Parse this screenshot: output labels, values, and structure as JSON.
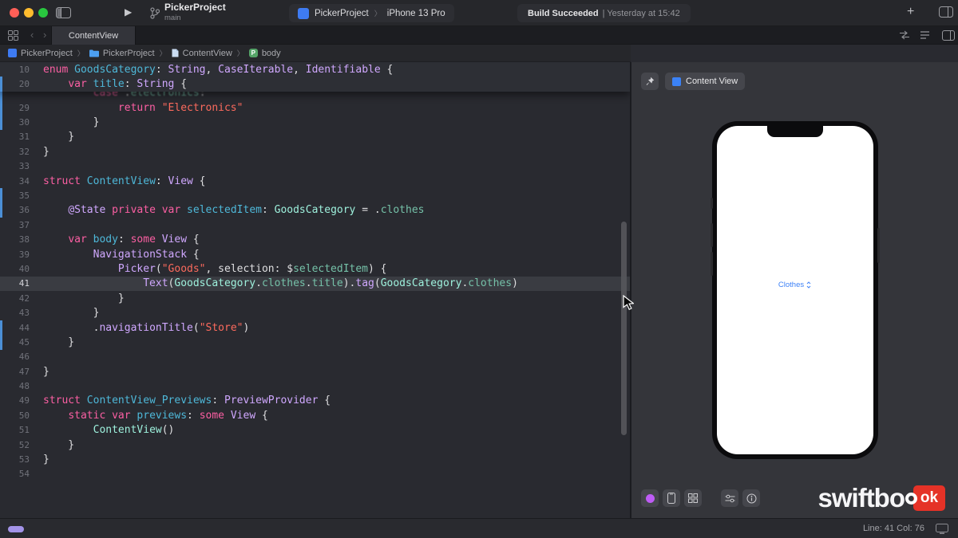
{
  "icons": {
    "chevron": "〉",
    "back": "‹",
    "forward": "›",
    "plus": "+",
    "play": "▶",
    "body_badge": "P"
  },
  "toolbar": {
    "project_name": "PickerProject",
    "branch_name": "main",
    "scheme_name": "PickerProject",
    "run_destination": "iPhone 13 Pro",
    "build_status": "Build Succeeded",
    "build_time": "| Yesterday at 15:42"
  },
  "tabbar": {
    "active_tab": "ContentView"
  },
  "jumpbar": {
    "items": [
      {
        "label": "PickerProject"
      },
      {
        "label": "PickerProject"
      },
      {
        "label": "ContentView"
      },
      {
        "label": "body"
      }
    ]
  },
  "syntax": {
    "k": "#FC5FA3",
    "s": "#FC6A5D",
    "d": "#4EB8D9",
    "v": "#D0A8FF",
    "m": "#9EF1DD",
    "g": "#75C1A8",
    "a": "#D0A8FF",
    "p": "#DFDFE1"
  },
  "code": {
    "current": "41",
    "sticky": [
      {
        "n": "10",
        "chg": false,
        "toks": [
          [
            "k",
            "enum"
          ],
          [
            "p",
            " "
          ],
          [
            "d",
            "GoodsCategory"
          ],
          [
            "p",
            ": "
          ],
          [
            "v",
            "String"
          ],
          [
            "p",
            ", "
          ],
          [
            "v",
            "CaseIterable"
          ],
          [
            "p",
            ", "
          ],
          [
            "v",
            "Identifiable"
          ],
          [
            "p",
            " {"
          ]
        ]
      },
      {
        "n": "20",
        "chg": true,
        "toks": [
          [
            "p",
            "    "
          ],
          [
            "k",
            "var"
          ],
          [
            "p",
            " "
          ],
          [
            "d",
            "title"
          ],
          [
            "p",
            ": "
          ],
          [
            "v",
            "String"
          ],
          [
            "p",
            " {"
          ]
        ]
      }
    ],
    "partial": {
      "n": "",
      "chg": true,
      "toks": [
        [
          "p",
          "        "
        ],
        [
          "k",
          "case"
        ],
        [
          "p",
          " ."
        ],
        [
          "g",
          "electronics"
        ],
        [
          "p",
          ":"
        ]
      ]
    },
    "lines": [
      {
        "n": "29",
        "chg": true,
        "toks": [
          [
            "p",
            "            "
          ],
          [
            "k",
            "return"
          ],
          [
            "p",
            " "
          ],
          [
            "s",
            "\"Electronics\""
          ]
        ]
      },
      {
        "n": "30",
        "chg": true,
        "toks": [
          [
            "p",
            "        }"
          ]
        ]
      },
      {
        "n": "31",
        "toks": [
          [
            "p",
            "    }"
          ]
        ]
      },
      {
        "n": "32",
        "toks": [
          [
            "p",
            "}"
          ]
        ]
      },
      {
        "n": "33",
        "toks": []
      },
      {
        "n": "34",
        "toks": [
          [
            "k",
            "struct"
          ],
          [
            "p",
            " "
          ],
          [
            "d",
            "ContentView"
          ],
          [
            "p",
            ": "
          ],
          [
            "v",
            "View"
          ],
          [
            "p",
            " {"
          ]
        ]
      },
      {
        "n": "35",
        "chg": true,
        "toks": []
      },
      {
        "n": "36",
        "chg": true,
        "toks": [
          [
            "p",
            "    "
          ],
          [
            "a",
            "@State"
          ],
          [
            "p",
            " "
          ],
          [
            "k",
            "private"
          ],
          [
            "p",
            " "
          ],
          [
            "k",
            "var"
          ],
          [
            "p",
            " "
          ],
          [
            "d",
            "selectedItem"
          ],
          [
            "p",
            ": "
          ],
          [
            "m",
            "GoodsCategory"
          ],
          [
            "p",
            " = ."
          ],
          [
            "g",
            "clothes"
          ]
        ]
      },
      {
        "n": "37",
        "toks": []
      },
      {
        "n": "38",
        "toks": [
          [
            "p",
            "    "
          ],
          [
            "k",
            "var"
          ],
          [
            "p",
            " "
          ],
          [
            "d",
            "body"
          ],
          [
            "p",
            ": "
          ],
          [
            "k",
            "some"
          ],
          [
            "p",
            " "
          ],
          [
            "v",
            "View"
          ],
          [
            "p",
            " {"
          ]
        ]
      },
      {
        "n": "39",
        "toks": [
          [
            "p",
            "        "
          ],
          [
            "v",
            "NavigationStack"
          ],
          [
            "p",
            " {"
          ]
        ]
      },
      {
        "n": "40",
        "toks": [
          [
            "p",
            "            "
          ],
          [
            "v",
            "Picker"
          ],
          [
            "p",
            "("
          ],
          [
            "s",
            "\"Goods\""
          ],
          [
            "p",
            ", selection: $"
          ],
          [
            "g",
            "selectedItem"
          ],
          [
            "p",
            ") {"
          ]
        ]
      },
      {
        "n": "41",
        "cur": true,
        "toks": [
          [
            "p",
            "                "
          ],
          [
            "v",
            "Text"
          ],
          [
            "p",
            "("
          ],
          [
            "m",
            "GoodsCategory"
          ],
          [
            "p",
            "."
          ],
          [
            "g",
            "clothes"
          ],
          [
            "p",
            "."
          ],
          [
            "g",
            "title"
          ],
          [
            "p",
            ")."
          ],
          [
            "v",
            "tag"
          ],
          [
            "p",
            "("
          ],
          [
            "m",
            "GoodsCategory"
          ],
          [
            "p",
            "."
          ],
          [
            "g",
            "clothes"
          ],
          [
            "p",
            ")"
          ]
        ]
      },
      {
        "n": "42",
        "toks": [
          [
            "p",
            "            }"
          ]
        ]
      },
      {
        "n": "43",
        "toks": [
          [
            "p",
            "        }"
          ]
        ]
      },
      {
        "n": "44",
        "chg": true,
        "toks": [
          [
            "p",
            "        ."
          ],
          [
            "v",
            "navigationTitle"
          ],
          [
            "p",
            "("
          ],
          [
            "s",
            "\"Store\""
          ],
          [
            "p",
            ")"
          ]
        ]
      },
      {
        "n": "45",
        "chg": true,
        "toks": [
          [
            "p",
            "    }"
          ]
        ]
      },
      {
        "n": "46",
        "toks": []
      },
      {
        "n": "47",
        "toks": [
          [
            "p",
            "}"
          ]
        ]
      },
      {
        "n": "48",
        "toks": []
      },
      {
        "n": "49",
        "toks": [
          [
            "k",
            "struct"
          ],
          [
            "p",
            " "
          ],
          [
            "d",
            "ContentView_Previews"
          ],
          [
            "p",
            ": "
          ],
          [
            "v",
            "PreviewProvider"
          ],
          [
            "p",
            " {"
          ]
        ]
      },
      {
        "n": "50",
        "toks": [
          [
            "p",
            "    "
          ],
          [
            "k",
            "static"
          ],
          [
            "p",
            " "
          ],
          [
            "k",
            "var"
          ],
          [
            "p",
            " "
          ],
          [
            "d",
            "previews"
          ],
          [
            "p",
            ": "
          ],
          [
            "k",
            "some"
          ],
          [
            "p",
            " "
          ],
          [
            "v",
            "View"
          ],
          [
            "p",
            " {"
          ]
        ]
      },
      {
        "n": "51",
        "toks": [
          [
            "p",
            "        "
          ],
          [
            "m",
            "ContentView"
          ],
          [
            "p",
            "()"
          ]
        ]
      },
      {
        "n": "52",
        "toks": [
          [
            "p",
            "    }"
          ]
        ]
      },
      {
        "n": "53",
        "toks": [
          [
            "p",
            "}"
          ]
        ]
      },
      {
        "n": "54",
        "toks": []
      }
    ]
  },
  "preview": {
    "chip_label": "Content View",
    "picker_value": "Clothes",
    "watermark_text": "swiftbo",
    "watermark_badge": "ok"
  },
  "statusbar": {
    "position": "Line: 41  Col: 76"
  }
}
